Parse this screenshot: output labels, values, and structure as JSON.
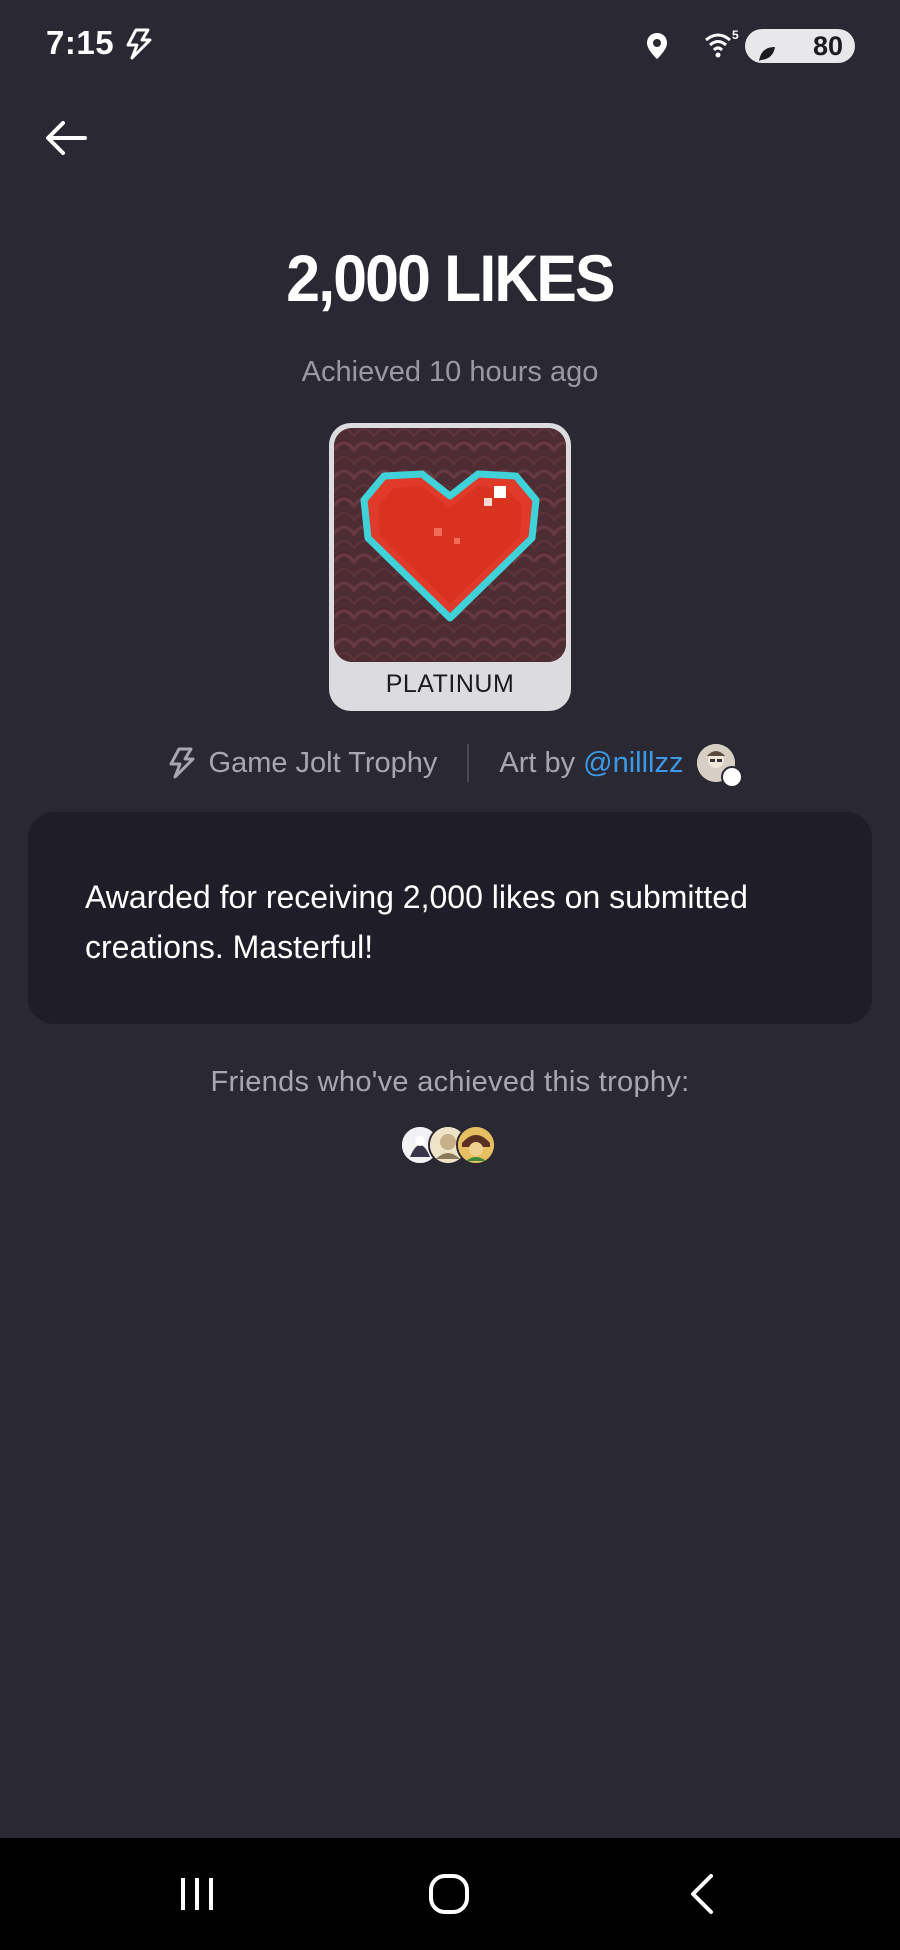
{
  "status_bar": {
    "time": "7:15",
    "battery": "80",
    "wifi_label": "5"
  },
  "trophy": {
    "title": "2,000 LIKES",
    "achieved": "Achieved 10 hours ago",
    "tier": "PLATINUM",
    "source": "Game Jolt Trophy",
    "art_by_label": "Art by",
    "artist": "@nilllzz",
    "description": "Awarded for receiving 2,000 likes on submitted creations. Masterful!"
  },
  "friends": {
    "label": "Friends who've achieved this trophy:"
  },
  "colors": {
    "background": "#2a2832",
    "card": "#1f1d27",
    "link": "#3b9ae8",
    "tier_card": "#dcdce0",
    "heart": "#e03a2a",
    "heart_outline": "#3fd2d8"
  }
}
